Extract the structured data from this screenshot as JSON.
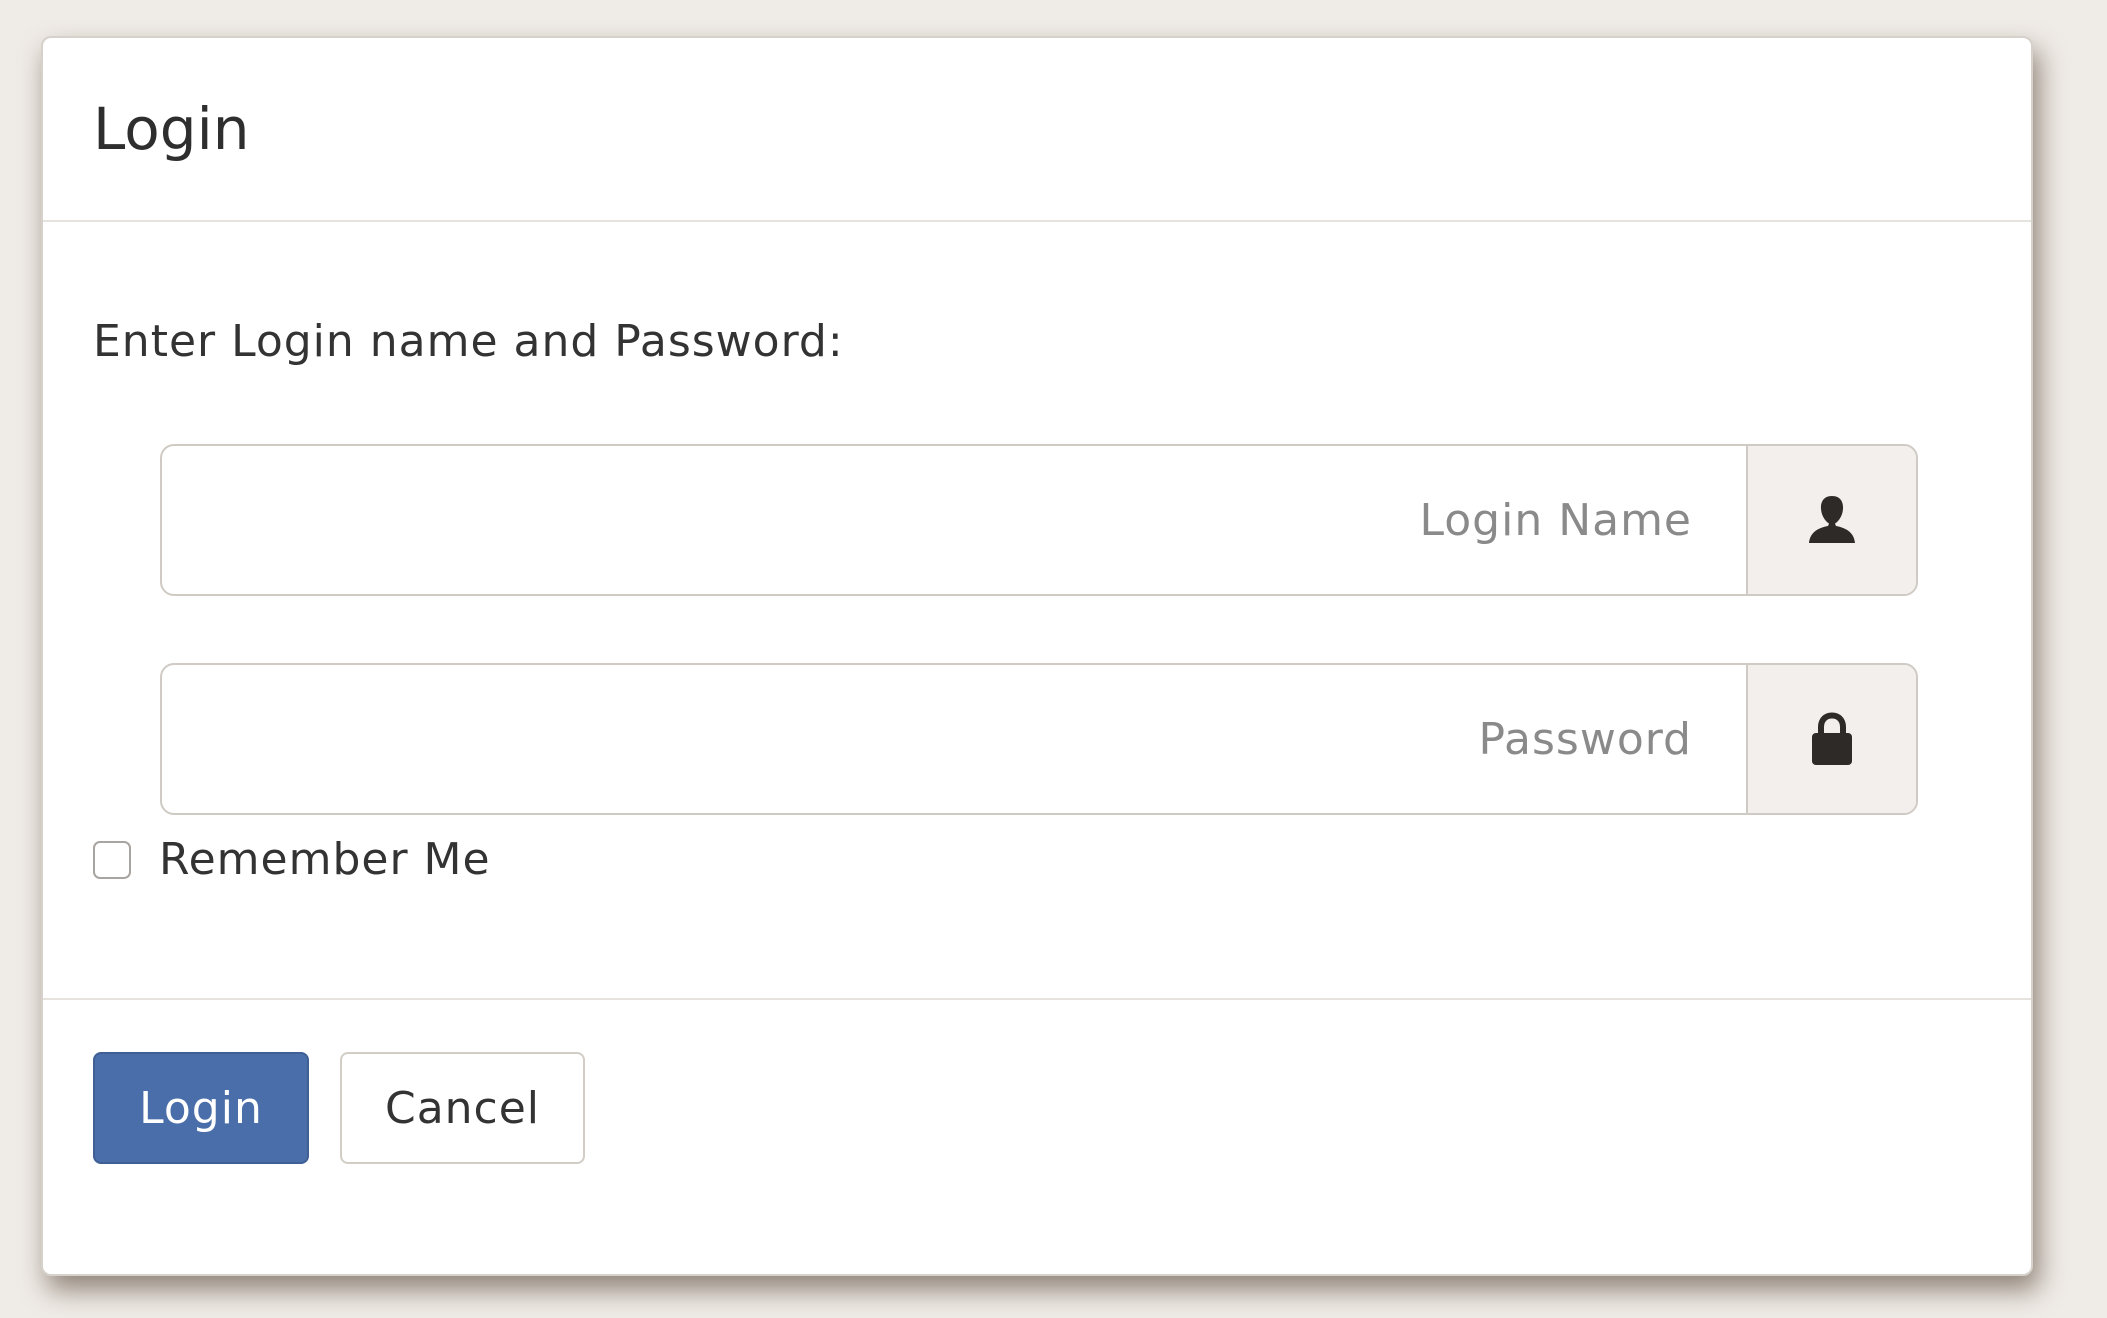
{
  "dialog": {
    "title": "Login",
    "prompt": "Enter Login name and Password:",
    "login_field": {
      "value": "",
      "placeholder": "Login Name",
      "icon": "user-icon"
    },
    "password_field": {
      "value": "",
      "placeholder": "Password",
      "icon": "lock-icon"
    },
    "remember_me": {
      "label": "Remember Me",
      "checked": false
    },
    "buttons": {
      "login_label": "Login",
      "cancel_label": "Cancel"
    }
  },
  "colors": {
    "primary": "#4a6ea9",
    "page_background": "#efebe6",
    "addon_background": "#f2efec"
  }
}
